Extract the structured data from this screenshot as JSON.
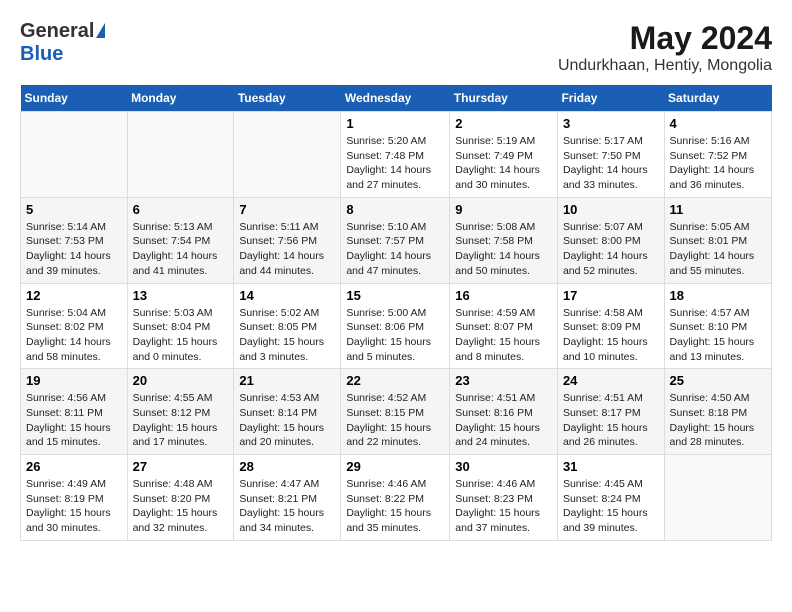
{
  "header": {
    "logo": {
      "general": "General",
      "blue": "Blue"
    },
    "title": "May 2024",
    "location": "Undurkhaan, Hentiy, Mongolia"
  },
  "calendar": {
    "headers": [
      "Sunday",
      "Monday",
      "Tuesday",
      "Wednesday",
      "Thursday",
      "Friday",
      "Saturday"
    ],
    "weeks": [
      [
        {
          "day": "",
          "info": ""
        },
        {
          "day": "",
          "info": ""
        },
        {
          "day": "",
          "info": ""
        },
        {
          "day": "1",
          "info": "Sunrise: 5:20 AM\nSunset: 7:48 PM\nDaylight: 14 hours\nand 27 minutes."
        },
        {
          "day": "2",
          "info": "Sunrise: 5:19 AM\nSunset: 7:49 PM\nDaylight: 14 hours\nand 30 minutes."
        },
        {
          "day": "3",
          "info": "Sunrise: 5:17 AM\nSunset: 7:50 PM\nDaylight: 14 hours\nand 33 minutes."
        },
        {
          "day": "4",
          "info": "Sunrise: 5:16 AM\nSunset: 7:52 PM\nDaylight: 14 hours\nand 36 minutes."
        }
      ],
      [
        {
          "day": "5",
          "info": "Sunrise: 5:14 AM\nSunset: 7:53 PM\nDaylight: 14 hours\nand 39 minutes."
        },
        {
          "day": "6",
          "info": "Sunrise: 5:13 AM\nSunset: 7:54 PM\nDaylight: 14 hours\nand 41 minutes."
        },
        {
          "day": "7",
          "info": "Sunrise: 5:11 AM\nSunset: 7:56 PM\nDaylight: 14 hours\nand 44 minutes."
        },
        {
          "day": "8",
          "info": "Sunrise: 5:10 AM\nSunset: 7:57 PM\nDaylight: 14 hours\nand 47 minutes."
        },
        {
          "day": "9",
          "info": "Sunrise: 5:08 AM\nSunset: 7:58 PM\nDaylight: 14 hours\nand 50 minutes."
        },
        {
          "day": "10",
          "info": "Sunrise: 5:07 AM\nSunset: 8:00 PM\nDaylight: 14 hours\nand 52 minutes."
        },
        {
          "day": "11",
          "info": "Sunrise: 5:05 AM\nSunset: 8:01 PM\nDaylight: 14 hours\nand 55 minutes."
        }
      ],
      [
        {
          "day": "12",
          "info": "Sunrise: 5:04 AM\nSunset: 8:02 PM\nDaylight: 14 hours\nand 58 minutes."
        },
        {
          "day": "13",
          "info": "Sunrise: 5:03 AM\nSunset: 8:04 PM\nDaylight: 15 hours\nand 0 minutes."
        },
        {
          "day": "14",
          "info": "Sunrise: 5:02 AM\nSunset: 8:05 PM\nDaylight: 15 hours\nand 3 minutes."
        },
        {
          "day": "15",
          "info": "Sunrise: 5:00 AM\nSunset: 8:06 PM\nDaylight: 15 hours\nand 5 minutes."
        },
        {
          "day": "16",
          "info": "Sunrise: 4:59 AM\nSunset: 8:07 PM\nDaylight: 15 hours\nand 8 minutes."
        },
        {
          "day": "17",
          "info": "Sunrise: 4:58 AM\nSunset: 8:09 PM\nDaylight: 15 hours\nand 10 minutes."
        },
        {
          "day": "18",
          "info": "Sunrise: 4:57 AM\nSunset: 8:10 PM\nDaylight: 15 hours\nand 13 minutes."
        }
      ],
      [
        {
          "day": "19",
          "info": "Sunrise: 4:56 AM\nSunset: 8:11 PM\nDaylight: 15 hours\nand 15 minutes."
        },
        {
          "day": "20",
          "info": "Sunrise: 4:55 AM\nSunset: 8:12 PM\nDaylight: 15 hours\nand 17 minutes."
        },
        {
          "day": "21",
          "info": "Sunrise: 4:53 AM\nSunset: 8:14 PM\nDaylight: 15 hours\nand 20 minutes."
        },
        {
          "day": "22",
          "info": "Sunrise: 4:52 AM\nSunset: 8:15 PM\nDaylight: 15 hours\nand 22 minutes."
        },
        {
          "day": "23",
          "info": "Sunrise: 4:51 AM\nSunset: 8:16 PM\nDaylight: 15 hours\nand 24 minutes."
        },
        {
          "day": "24",
          "info": "Sunrise: 4:51 AM\nSunset: 8:17 PM\nDaylight: 15 hours\nand 26 minutes."
        },
        {
          "day": "25",
          "info": "Sunrise: 4:50 AM\nSunset: 8:18 PM\nDaylight: 15 hours\nand 28 minutes."
        }
      ],
      [
        {
          "day": "26",
          "info": "Sunrise: 4:49 AM\nSunset: 8:19 PM\nDaylight: 15 hours\nand 30 minutes."
        },
        {
          "day": "27",
          "info": "Sunrise: 4:48 AM\nSunset: 8:20 PM\nDaylight: 15 hours\nand 32 minutes."
        },
        {
          "day": "28",
          "info": "Sunrise: 4:47 AM\nSunset: 8:21 PM\nDaylight: 15 hours\nand 34 minutes."
        },
        {
          "day": "29",
          "info": "Sunrise: 4:46 AM\nSunset: 8:22 PM\nDaylight: 15 hours\nand 35 minutes."
        },
        {
          "day": "30",
          "info": "Sunrise: 4:46 AM\nSunset: 8:23 PM\nDaylight: 15 hours\nand 37 minutes."
        },
        {
          "day": "31",
          "info": "Sunrise: 4:45 AM\nSunset: 8:24 PM\nDaylight: 15 hours\nand 39 minutes."
        },
        {
          "day": "",
          "info": ""
        }
      ]
    ]
  }
}
